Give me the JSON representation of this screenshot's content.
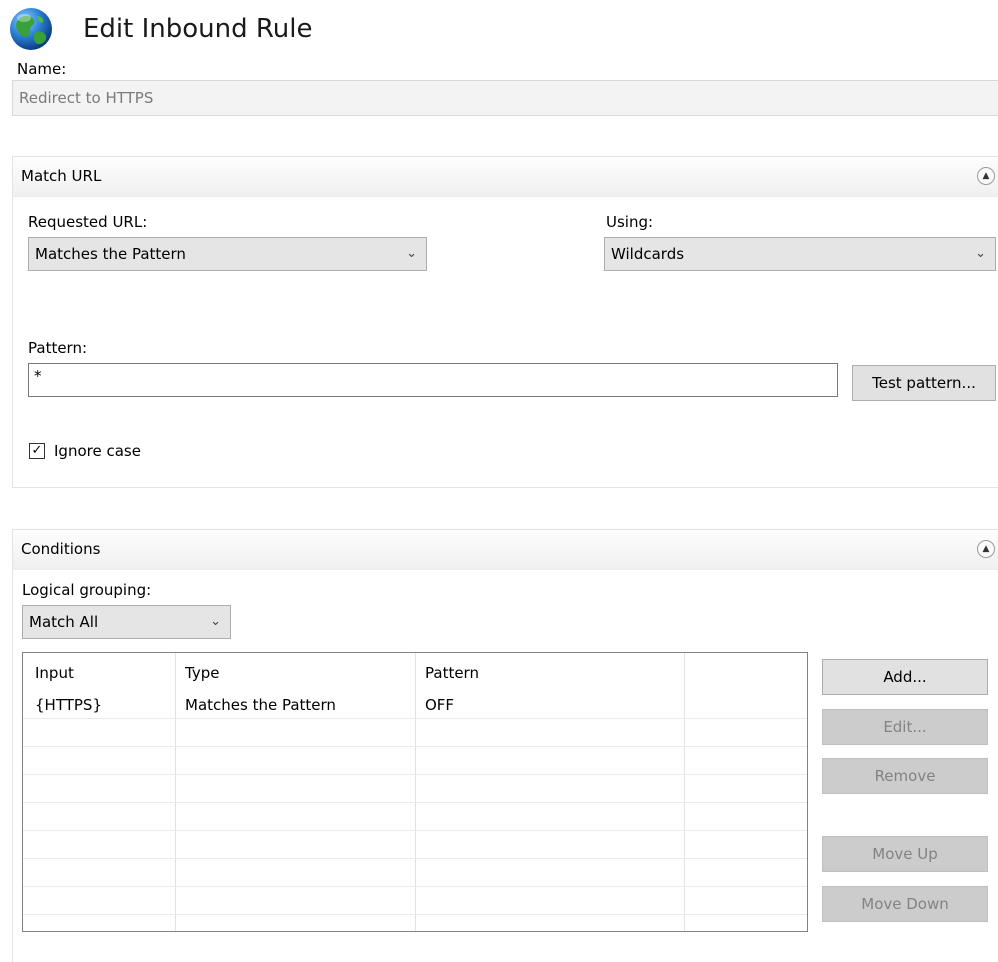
{
  "header": {
    "title": "Edit Inbound Rule"
  },
  "name": {
    "label": "Name:",
    "value": "Redirect to HTTPS"
  },
  "match_url": {
    "section_title": "Match URL",
    "requested_url_label": "Requested URL:",
    "requested_url_value": "Matches the Pattern",
    "using_label": "Using:",
    "using_value": "Wildcards",
    "pattern_label": "Pattern:",
    "pattern_value": "*",
    "test_pattern_button": "Test pattern...",
    "ignore_case_label": "Ignore case",
    "ignore_case_checked": true
  },
  "conditions": {
    "section_title": "Conditions",
    "logical_grouping_label": "Logical grouping:",
    "logical_grouping_value": "Match All",
    "columns": [
      "Input",
      "Type",
      "Pattern"
    ],
    "rows": [
      {
        "input": "{HTTPS}",
        "type": "Matches the Pattern",
        "pattern": "OFF"
      }
    ],
    "buttons": {
      "add": "Add...",
      "edit": "Edit...",
      "remove": "Remove",
      "move_up": "Move Up",
      "move_down": "Move Down"
    }
  },
  "colors": {
    "disabled_button": "#cccccc",
    "field_disabled": "#f3f3f3"
  }
}
